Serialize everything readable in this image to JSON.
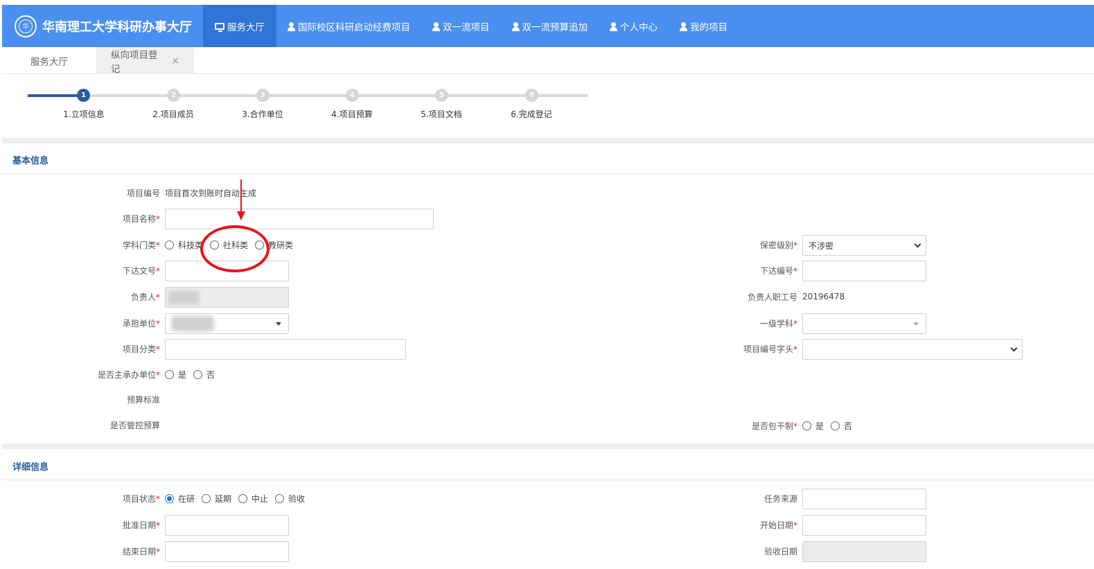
{
  "brand": {
    "title": "华南理工大学科研办事大厅",
    "logo_text": "华"
  },
  "nav": {
    "items": [
      {
        "label": "服务大厅",
        "icon": "monitor-icon",
        "active": true
      },
      {
        "label": "国际校区科研启动经费项目",
        "icon": "user-icon",
        "active": false
      },
      {
        "label": "双一流项目",
        "icon": "user-icon",
        "active": false
      },
      {
        "label": "双一流预算追加",
        "icon": "user-icon",
        "active": false
      },
      {
        "label": "个人中心",
        "icon": "user-icon",
        "active": false
      },
      {
        "label": "我的项目",
        "icon": "user-icon",
        "active": false
      }
    ]
  },
  "tabs": {
    "home": "服务大厅",
    "current": "纵向项目登记",
    "close": "×"
  },
  "steps": [
    {
      "num": "1",
      "label": "1.立项信息",
      "active": true
    },
    {
      "num": "2",
      "label": "2.项目成员",
      "active": false
    },
    {
      "num": "3",
      "label": "3.合作单位",
      "active": false
    },
    {
      "num": "4",
      "label": "4.项目预算",
      "active": false
    },
    {
      "num": "5",
      "label": "5.项目文档",
      "active": false
    },
    {
      "num": "6",
      "label": "6.完成登记",
      "active": false
    }
  ],
  "basic": {
    "title": "基本信息",
    "project_no_label": "项目编号",
    "project_no_value": "项目首次到账时自动生成",
    "project_name_label": "项目名称",
    "discipline_label": "学科门类",
    "discipline_options": [
      "科技类",
      "社科类",
      "教研类"
    ],
    "secrecy_label": "保密级别",
    "secrecy_value": "不涉密",
    "doc_no_label": "下达文号",
    "issue_no_label": "下达编号",
    "leader_label": "负责人",
    "leader_id_label": "负责人职工号",
    "leader_id_value": "20196478",
    "unit_label": "承担单位",
    "primary_subject_label": "一级学科",
    "category_label": "项目分类",
    "prefix_label": "项目编号字头",
    "host_unit_label": "是否主承办单位",
    "yes": "是",
    "no": "否",
    "budget_std_label": "预算标准",
    "budget_ctrl_label": "是否管控预算",
    "lump_sum_label": "是否包干制",
    "required_mark": "*"
  },
  "detail": {
    "title": "详细信息",
    "status_label": "项目状态",
    "status_options": [
      "在研",
      "延期",
      "中止",
      "验收"
    ],
    "status_selected": "在研",
    "task_source_label": "任务来源",
    "approve_date_label": "批准日期",
    "start_date_label": "开始日期",
    "end_date_label": "结束日期",
    "accept_date_label": "验收日期"
  },
  "colors": {
    "nav_bg": "#4a8ff0",
    "nav_active": "#2f74d6",
    "step_active": "#2e5a9c",
    "section_title": "#2a5c9a",
    "required": "#e02020",
    "annotation": "#e8121b"
  }
}
